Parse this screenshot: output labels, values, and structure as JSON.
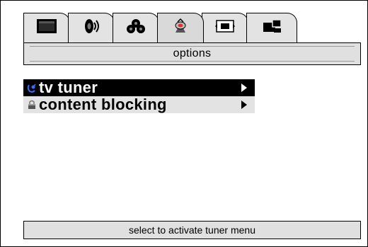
{
  "tabs": [
    {
      "icon": "tv-screen-icon",
      "active": false
    },
    {
      "icon": "speaker-sound-icon",
      "active": false
    },
    {
      "icon": "film-reels-icon",
      "active": false
    },
    {
      "icon": "satellite-dish-icon",
      "active": true
    },
    {
      "icon": "aspect-ratio-icon",
      "active": false
    },
    {
      "icon": "picture-in-picture-icon",
      "active": false
    }
  ],
  "section": {
    "title": "options"
  },
  "menu": {
    "items": [
      {
        "label": "tv tuner",
        "icon": "antenna-icon",
        "selected": true
      },
      {
        "label": "content blocking",
        "icon": "lock-icon",
        "selected": false
      }
    ]
  },
  "status": {
    "text": "select to activate tuner menu"
  },
  "colors": {
    "tab_background": "#e3e3e3",
    "selected_row": "#000000",
    "unselected_row": "#e3e3e3",
    "antenna_icon": "#1f4fd8",
    "bar_background": "#e0e0e0"
  }
}
